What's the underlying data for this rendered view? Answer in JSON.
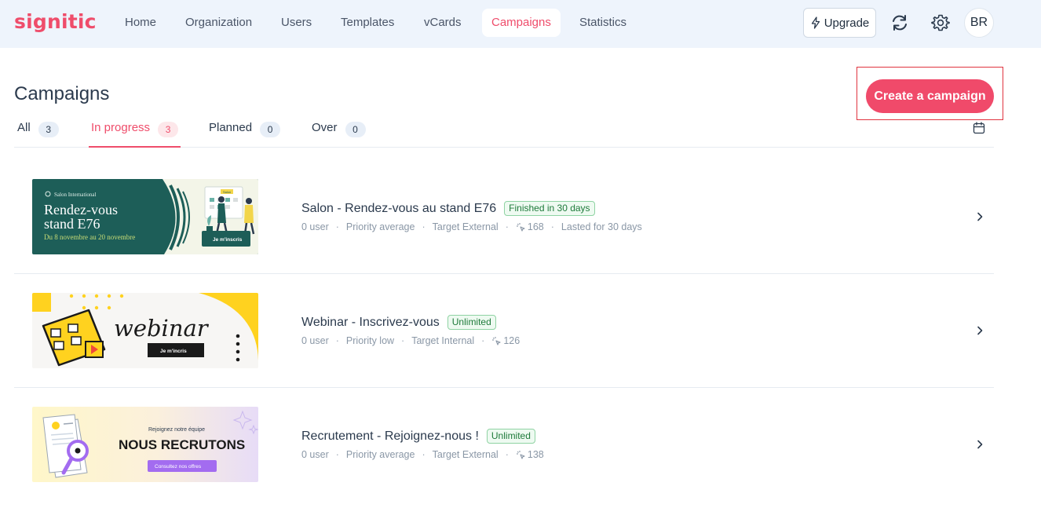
{
  "app": {
    "logo": "signitic"
  },
  "nav": {
    "items": [
      "Home",
      "Organization",
      "Users",
      "Templates",
      "vCards",
      "Campaigns",
      "Statistics"
    ],
    "active": "Campaigns",
    "upgrade_label": "Upgrade",
    "avatar_initials": "BR"
  },
  "page": {
    "title": "Campaigns",
    "create_label": "Create a campaign"
  },
  "tabs": [
    {
      "label": "All",
      "count": "3"
    },
    {
      "label": "In progress",
      "count": "3"
    },
    {
      "label": "Planned",
      "count": "0"
    },
    {
      "label": "Over",
      "count": "0"
    }
  ],
  "active_tab": "In progress",
  "campaigns": [
    {
      "title": "Salon - Rendez-vous au stand E76",
      "status": "Finished in 30 days",
      "users": "0 user",
      "priority": "Priority average",
      "target": "Target External",
      "clicks": "168",
      "duration": "Lasted for 30 days",
      "banner": {
        "eyebrow": "Salon International",
        "headline_1": "Rendez-vous",
        "headline_2": "stand E76",
        "dates": "Du 8 novembre au 20 novembre",
        "cta": "Je m'inscris",
        "calendar_tag": "Salon"
      }
    },
    {
      "title": "Webinar - Inscrivez-vous",
      "status": "Unlimited",
      "users": "0 user",
      "priority": "Priority low",
      "target": "Target Internal",
      "clicks": "126",
      "banner": {
        "headline": "webinar",
        "cta": "Je m'incris"
      }
    },
    {
      "title": "Recrutement - Rejoignez-nous !",
      "status": "Unlimited",
      "users": "0 user",
      "priority": "Priority average",
      "target": "Target External",
      "clicks": "138",
      "banner": {
        "eyebrow": "Rejoignez notre équipe",
        "headline": "NOUS RECRUTONS",
        "cta": "Consultez nos offres"
      }
    }
  ],
  "colors": {
    "brand": "#ef4d6b",
    "nav_bg": "#eef4fc",
    "badge_green": "#1e7a3a",
    "banner1_bg": "#1d5e58",
    "banner2_accent": "#ffd21f",
    "banner3_accent": "#a36cf0"
  },
  "icons": {
    "upgrade": "lightning-icon",
    "sync": "sync-icon",
    "settings": "gear-icon",
    "calendar": "calendar-icon",
    "row_action": "chevron-right-icon",
    "clicks": "click-icon"
  }
}
